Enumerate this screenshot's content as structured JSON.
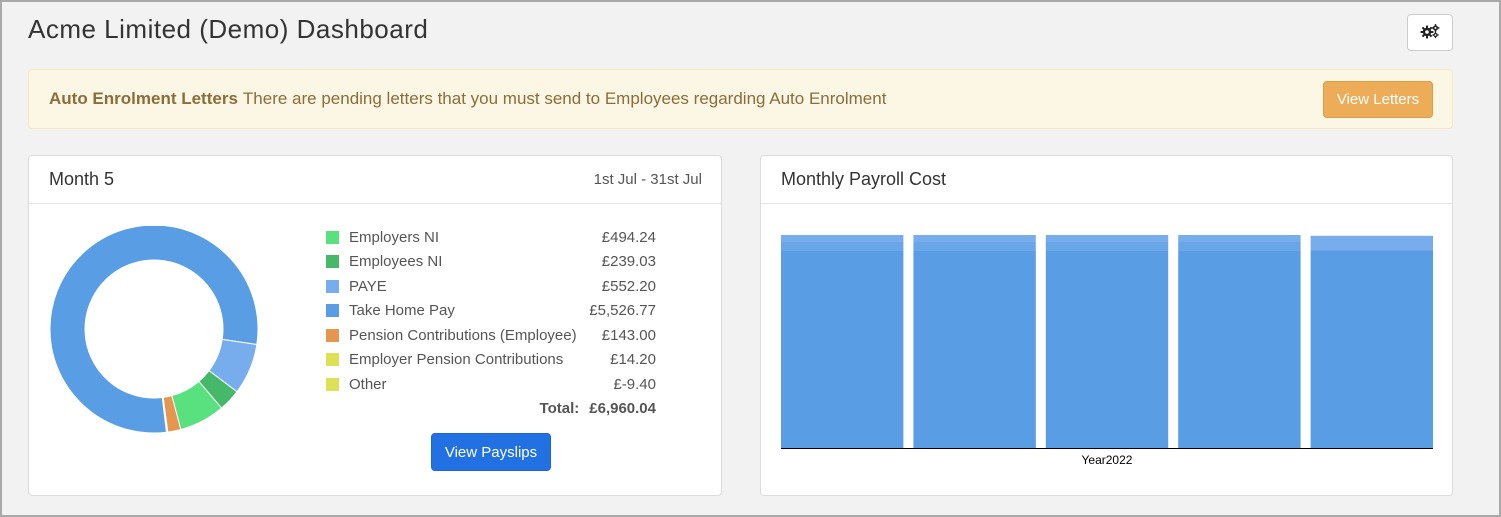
{
  "header": {
    "title": "Acme Limited (Demo) Dashboard",
    "settings_icon": "gears-icon"
  },
  "alert": {
    "strong": "Auto Enrolment Letters",
    "message": "There are pending letters that you must send to Employees regarding Auto Enrolment",
    "button_label": "View Letters",
    "color": "#8a6d3b",
    "background": "#fcf6e4"
  },
  "month_panel": {
    "title": "Month 5",
    "date_range": "1st Jul - 31st Jul",
    "items": [
      {
        "label": "Employers NI",
        "value": "£494.24",
        "amount": 494.24,
        "color": "#59e07f"
      },
      {
        "label": "Employees NI",
        "value": "£239.03",
        "amount": 239.03,
        "color": "#45b86a"
      },
      {
        "label": "PAYE",
        "value": "£552.20",
        "amount": 552.2,
        "color": "#77aded"
      },
      {
        "label": "Take Home Pay",
        "value": "£5,526.77",
        "amount": 5526.77,
        "color": "#599de5"
      },
      {
        "label": "Pension Contributions (Employee)",
        "value": "£143.00",
        "amount": 143.0,
        "color": "#e5974f"
      },
      {
        "label": "Employer Pension Contributions",
        "value": "£14.20",
        "amount": 14.2,
        "color": "#dde155"
      },
      {
        "label": "Other",
        "value": "£-9.40",
        "amount": -9.4,
        "color": "#dde155"
      }
    ],
    "total_label": "Total:",
    "total_value": "£6,960.04",
    "button_label": "View Payslips"
  },
  "payroll_panel": {
    "title": "Monthly Payroll Cost"
  },
  "chart_data": [
    {
      "type": "pie",
      "labels": [
        "Employers NI",
        "Employees NI",
        "PAYE",
        "Take Home Pay",
        "Pension Contributions (Employee)",
        "Employer Pension Contributions"
      ],
      "values": [
        494.24,
        239.03,
        552.2,
        5526.77,
        143.0,
        14.2
      ],
      "colors": [
        "#59e07f",
        "#45b86a",
        "#77aded",
        "#599de5",
        "#e5974f",
        "#dde155"
      ],
      "donut": true,
      "legend": "right"
    },
    {
      "type": "bar",
      "stacked": true,
      "categories": [
        "",
        "",
        "",
        "",
        ""
      ],
      "xlabel": "Year2022",
      "series": [
        {
          "values": [
            5526.77,
            5526.77,
            5526.77,
            5526.77,
            5526.77
          ],
          "color": "#599de5"
        },
        {
          "values": [
            239.03,
            239.03,
            239.03,
            239.03,
            0
          ],
          "color": "#68a6e8"
        },
        {
          "values": [
            183.4,
            183.4,
            183.4,
            183.4,
            400.0
          ],
          "color": "#77aded"
        }
      ],
      "grid": false
    }
  ]
}
